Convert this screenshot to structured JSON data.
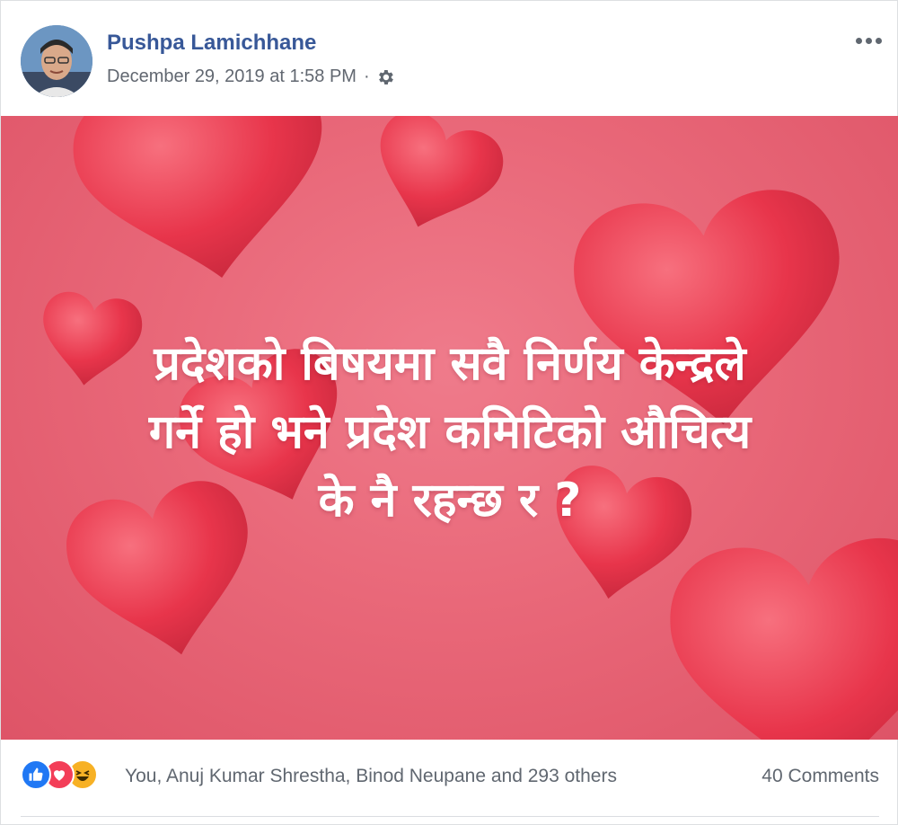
{
  "post": {
    "author": "Pushpa Lamichhane",
    "timestamp": "December 29, 2019 at 1:58 PM",
    "separator": "·",
    "privacy_icon": "gear-icon",
    "options_icon": "more-options-icon"
  },
  "image": {
    "text_lines": [
      "प्रदेशको बिषयमा सवै निर्णय केन्द्रले",
      "गर्ने हो भने प्रदेश कमिटिको औचित्य",
      "के नै रहन्छ र ?"
    ],
    "background_colors": {
      "base": "#e96879",
      "heart": "#ea3a4f"
    }
  },
  "footer": {
    "reaction_icons": [
      "like-icon",
      "love-icon",
      "haha-icon"
    ],
    "reacted_by": "You, Anuj Kumar Shrestha, Binod Neupane and 293 others",
    "comments": "40 Comments"
  },
  "colors": {
    "author_link": "#385898",
    "meta_text": "#616770",
    "like": "#2078f4",
    "love": "#f33e58",
    "haha": "#f7b125"
  }
}
